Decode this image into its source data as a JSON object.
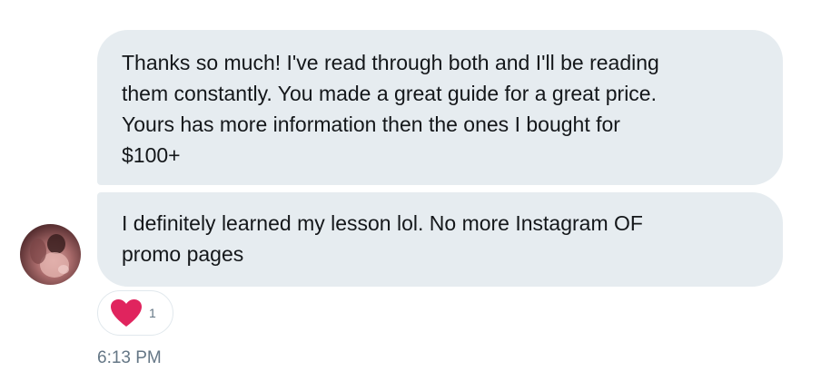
{
  "conversation": {
    "messages": [
      {
        "text": "Thanks so much! I've read through both and I'll be reading\nthem constantly. You made a great guide for a great price.\nYours has more information then the ones I bought for\n$100+"
      },
      {
        "text": "I definitely learned my lesson lol. No more Instagram OF\npromo pages"
      }
    ],
    "reaction": {
      "icon": "heart-icon",
      "color": "#e0245e",
      "count": "1"
    },
    "timestamp": "6:13 PM",
    "colors": {
      "bubble_background": "#e6ecf0",
      "message_text": "#14171a",
      "secondary_text": "#657786"
    }
  }
}
